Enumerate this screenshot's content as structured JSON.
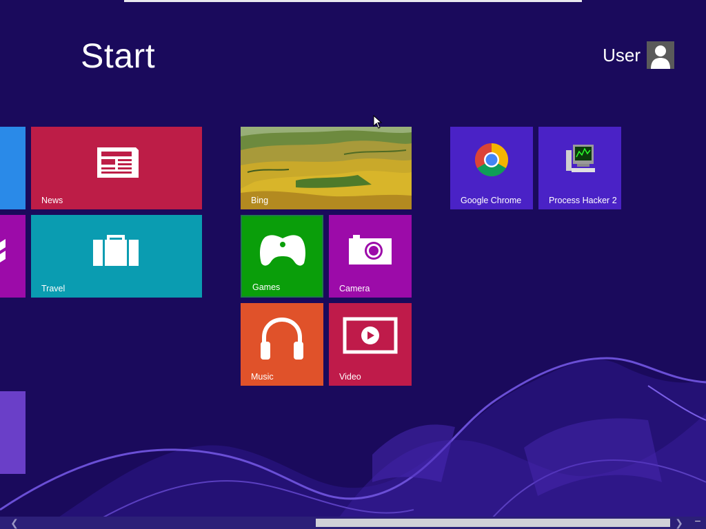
{
  "start": {
    "title": "Start"
  },
  "user": {
    "name": "User"
  },
  "tiles": {
    "news": {
      "label": "News",
      "color": "#bd1d47"
    },
    "travel": {
      "label": "Travel",
      "color": "#0a9cb1"
    },
    "bing": {
      "label": "Bing"
    },
    "games": {
      "label": "Games",
      "color": "#0a9e0a"
    },
    "camera": {
      "label": "Camera",
      "color": "#9c0ba9"
    },
    "music": {
      "label": "Music",
      "color": "#e0522a"
    },
    "video": {
      "label": "Video",
      "color": "#bf1b4a"
    },
    "chrome": {
      "label": "Google Chrome",
      "color": "#4a22c6"
    },
    "process_hacker": {
      "label": "Process Hacker 2",
      "color": "#4a22c6"
    }
  },
  "colors": {
    "background": "#1a0a5c",
    "scroll_thumb": "#d0d0d8"
  },
  "icons": {
    "news": "newspaper-icon",
    "travel": "suitcase-icon",
    "games": "gamepad-icon",
    "camera": "camera-icon",
    "music": "headphones-icon",
    "video": "play-icon",
    "chrome": "chrome-icon",
    "process_hacker": "computer-icon"
  }
}
